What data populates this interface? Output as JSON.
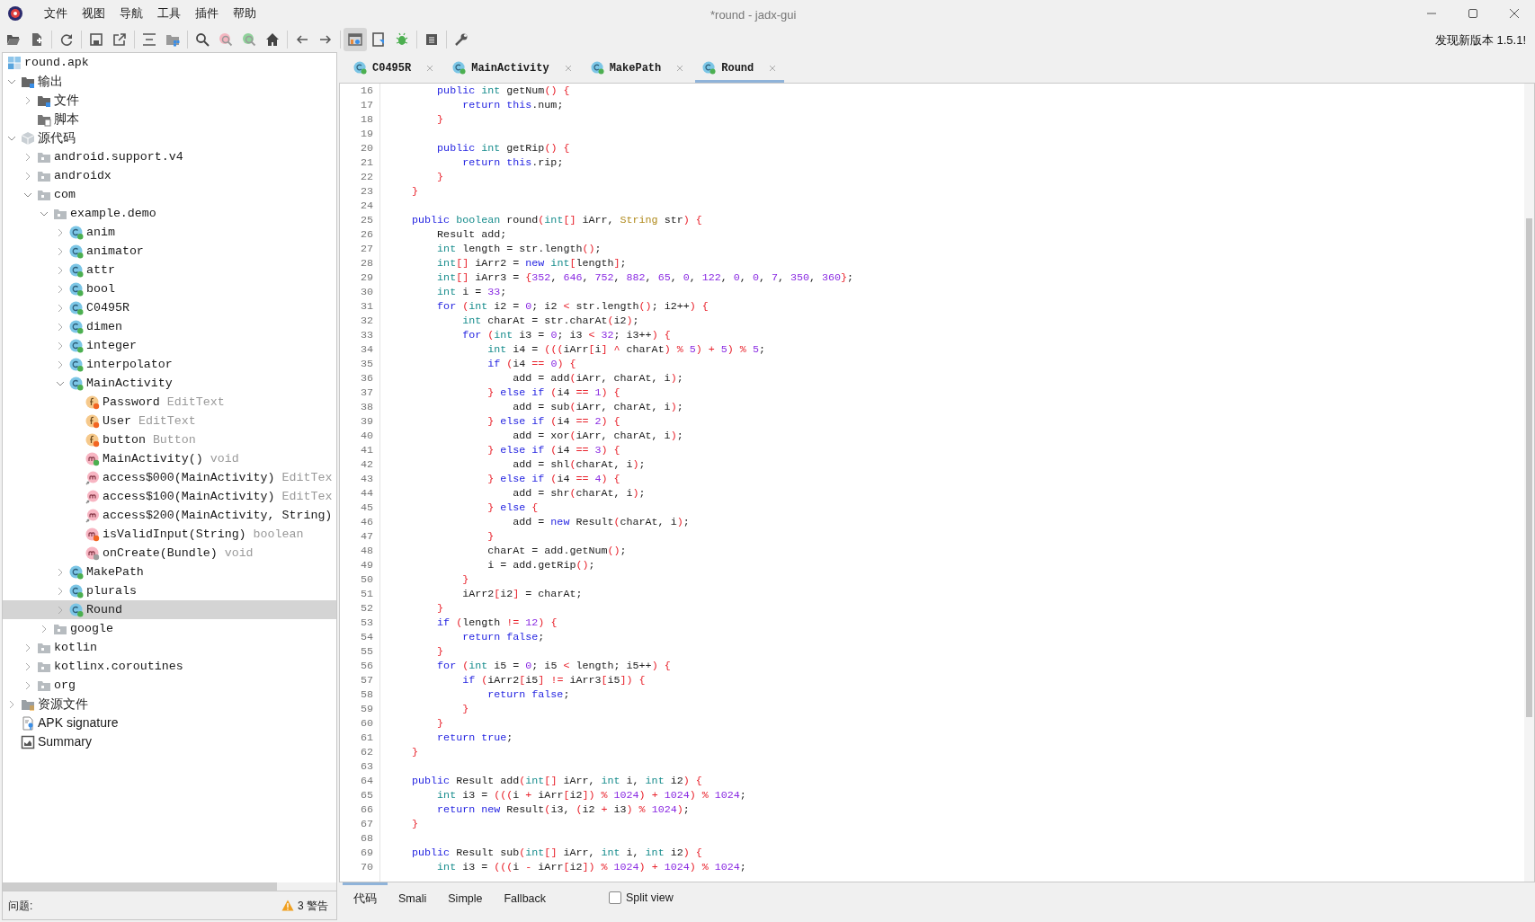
{
  "window": {
    "title": "*round - jadx-gui"
  },
  "menu": [
    "文件",
    "视图",
    "导航",
    "工具",
    "插件",
    "帮助"
  ],
  "update_notice": "发现新版本 1.5.1!",
  "tree": {
    "label": "round.apk",
    "kind": "apk",
    "selected": false,
    "children": [
      {
        "label": "输出",
        "kind": "output",
        "expanded": true,
        "selected": false,
        "children": [
          {
            "label": "文件",
            "kind": "output",
            "expanded": false,
            "selected": false
          },
          {
            "label": "脚本",
            "kind": "script-folder",
            "selected": false
          }
        ]
      },
      {
        "label": "源代码",
        "kind": "sources",
        "expanded": true,
        "selected": false,
        "children": [
          {
            "label": "android.support.v4",
            "kind": "package",
            "expanded": false,
            "selected": false
          },
          {
            "label": "androidx",
            "kind": "package",
            "expanded": false,
            "selected": false
          },
          {
            "label": "com",
            "kind": "package",
            "expanded": true,
            "selected": false,
            "children": [
              {
                "label": "example.demo",
                "kind": "package",
                "expanded": true,
                "selected": false,
                "children": [
                  {
                    "label": "anim",
                    "kind": "class",
                    "expanded": false,
                    "selected": false
                  },
                  {
                    "label": "animator",
                    "kind": "class",
                    "expanded": false,
                    "selected": false
                  },
                  {
                    "label": "attr",
                    "kind": "class",
                    "expanded": false,
                    "selected": false
                  },
                  {
                    "label": "bool",
                    "kind": "class",
                    "expanded": false,
                    "selected": false
                  },
                  {
                    "label": "C0495R",
                    "kind": "class",
                    "expanded": false,
                    "selected": false
                  },
                  {
                    "label": "dimen",
                    "kind": "class",
                    "expanded": false,
                    "selected": false
                  },
                  {
                    "label": "integer",
                    "kind": "class",
                    "expanded": false,
                    "selected": false
                  },
                  {
                    "label": "interpolator",
                    "kind": "class",
                    "expanded": false,
                    "selected": false
                  },
                  {
                    "label": "MainActivity",
                    "kind": "class",
                    "expanded": true,
                    "selected": false,
                    "children": [
                      {
                        "label": "Password",
                        "detail": "EditText",
                        "kind": "field",
                        "color": "#f26522",
                        "selected": false
                      },
                      {
                        "label": "User",
                        "detail": "EditText",
                        "kind": "field",
                        "color": "#f26522",
                        "selected": false
                      },
                      {
                        "label": "button",
                        "detail": "Button",
                        "kind": "field",
                        "color": "#f26522",
                        "selected": false
                      },
                      {
                        "label": "MainActivity()",
                        "detail": "void",
                        "kind": "method",
                        "color": "#4caf50",
                        "selected": false
                      },
                      {
                        "label": "access$000(MainActivity)",
                        "detail": "EditTex",
                        "kind": "accessor",
                        "selected": false
                      },
                      {
                        "label": "access$100(MainActivity)",
                        "detail": "EditTex",
                        "kind": "accessor",
                        "selected": false
                      },
                      {
                        "label": "access$200(MainActivity, String)",
                        "kind": "accessor",
                        "selected": false
                      },
                      {
                        "label": "isValidInput(String)",
                        "detail": "boolean",
                        "kind": "method",
                        "color": "#f26522",
                        "selected": false
                      },
                      {
                        "label": "onCreate(Bundle)",
                        "detail": "void",
                        "kind": "method",
                        "color": "#9e9e9e",
                        "selected": false
                      }
                    ]
                  },
                  {
                    "label": "MakePath",
                    "kind": "class",
                    "expanded": false,
                    "selected": false
                  },
                  {
                    "label": "plurals",
                    "kind": "class",
                    "expanded": false,
                    "selected": false
                  },
                  {
                    "label": "Round",
                    "kind": "class",
                    "expanded": false,
                    "selected": true
                  }
                ]
              },
              {
                "label": "google",
                "kind": "package",
                "expanded": false,
                "selected": false
              }
            ]
          },
          {
            "label": "kotlin",
            "kind": "package",
            "expanded": false,
            "selected": false
          },
          {
            "label": "kotlinx.coroutines",
            "kind": "package",
            "expanded": false,
            "selected": false
          },
          {
            "label": "org",
            "kind": "package",
            "expanded": false,
            "selected": false
          }
        ]
      },
      {
        "label": "资源文件",
        "kind": "resources",
        "expanded": false,
        "selected": false
      },
      {
        "label": "APK signature",
        "kind": "signature",
        "selected": false
      },
      {
        "label": "Summary",
        "kind": "summary",
        "selected": false
      }
    ]
  },
  "problems": {
    "label": "问题:",
    "warnings": "3 警告"
  },
  "editor_tabs": [
    {
      "label": "C0495R",
      "selected": false
    },
    {
      "label": "MainActivity",
      "selected": false
    },
    {
      "label": "MakePath",
      "selected": false
    },
    {
      "label": "Round",
      "selected": true
    }
  ],
  "code_lines": [
    {
      "n": "16",
      "segs": [
        {
          "text": "        public",
          "kind": "keyword"
        },
        {
          "text": " int",
          "kind": "type"
        },
        {
          "text": " getNum() {",
          "kind": "plain"
        }
      ]
    },
    {
      "n": "17",
      "segs": [
        {
          "text": "            return this",
          "kind": "keyword"
        },
        {
          "text": ".num;",
          "kind": "plain"
        }
      ]
    },
    {
      "n": "18",
      "segs": [
        {
          "text": "        }",
          "kind": "plain"
        }
      ]
    },
    {
      "n": "19"
    },
    {
      "n": "20",
      "segs": [
        {
          "text": "        public",
          "kind": "keyword"
        },
        {
          "text": " int",
          "kind": "type"
        },
        {
          "text": " getRip() {",
          "kind": "plain"
        }
      ]
    },
    {
      "n": "21",
      "segs": [
        {
          "text": "            return this",
          "kind": "keyword"
        },
        {
          "text": ".rip;",
          "kind": "plain"
        }
      ]
    },
    {
      "n": "22",
      "segs": [
        {
          "text": "        }",
          "kind": "plain"
        }
      ]
    },
    {
      "n": "23",
      "segs": [
        {
          "text": "    }",
          "kind": "plain"
        }
      ]
    },
    {
      "n": "24"
    },
    {
      "n": "25",
      "segs": [
        {
          "text": "    public",
          "kind": "keyword"
        },
        {
          "text": " boolean",
          "kind": "type"
        },
        {
          "text": " round(",
          "kind": "plain"
        },
        {
          "text": "int",
          "kind": "type"
        },
        {
          "text": "[] iArr,",
          "kind": "plain"
        },
        {
          "text": " String",
          "kind": "class"
        },
        {
          "text": " str) {",
          "kind": "plain"
        }
      ]
    },
    {
      "n": "26",
      "segs": [
        {
          "text": "        Result add;",
          "kind": "plain"
        }
      ]
    },
    {
      "n": "27",
      "segs": [
        {
          "text": "        int",
          "kind": "type"
        },
        {
          "text": " length = str.length();",
          "kind": "plain"
        }
      ]
    },
    {
      "n": "28",
      "segs": [
        {
          "text": "        int",
          "kind": "type"
        },
        {
          "text": "[] iArr2 =",
          "kind": "plain"
        },
        {
          "text": " new",
          "kind": "keyword"
        },
        {
          "text": " int",
          "kind": "type"
        },
        {
          "text": "[length];",
          "kind": "plain"
        }
      ]
    },
    {
      "n": "29",
      "segs": [
        {
          "text": "        int",
          "kind": "type"
        },
        {
          "text": "[] iArr3 = {352, 646, 752, 882, 65, 0, 122, 0, 0, 7, 350, 360};",
          "kind": "plain"
        }
      ]
    },
    {
      "n": "30",
      "segs": [
        {
          "text": "        int",
          "kind": "type"
        },
        {
          "text": " i = 33;",
          "kind": "plain"
        }
      ]
    },
    {
      "n": "31",
      "segs": [
        {
          "text": "        for",
          "kind": "keyword"
        },
        {
          "text": " (",
          "kind": "plain"
        },
        {
          "text": "int",
          "kind": "type"
        },
        {
          "text": " i2 = 0; i2 < str.length(); i2++) {",
          "kind": "plain"
        }
      ]
    },
    {
      "n": "32",
      "segs": [
        {
          "text": "            int",
          "kind": "type"
        },
        {
          "text": " charAt = str.charAt(i2);",
          "kind": "plain"
        }
      ]
    },
    {
      "n": "33",
      "segs": [
        {
          "text": "            for",
          "kind": "keyword"
        },
        {
          "text": " (",
          "kind": "plain"
        },
        {
          "text": "int",
          "kind": "type"
        },
        {
          "text": " i3 = 0; i3 < 32; i3++) {",
          "kind": "plain"
        }
      ]
    },
    {
      "n": "34",
      "segs": [
        {
          "text": "                int",
          "kind": "type"
        },
        {
          "text": " i4 = (((iArr[i] ^ charAt) % 5) + 5) % 5;",
          "kind": "plain"
        }
      ]
    },
    {
      "n": "35",
      "segs": [
        {
          "text": "                if",
          "kind": "keyword"
        },
        {
          "text": " (i4 == 0) {",
          "kind": "plain"
        }
      ]
    },
    {
      "n": "36",
      "segs": [
        {
          "text": "                    add = add(iArr, charAt, i);",
          "kind": "plain"
        }
      ]
    },
    {
      "n": "37",
      "segs": [
        {
          "text": "                }",
          "kind": "plain"
        },
        {
          "text": " else if",
          "kind": "keyword"
        },
        {
          "text": " (i4 == 1) {",
          "kind": "plain"
        }
      ]
    },
    {
      "n": "38",
      "segs": [
        {
          "text": "                    add = sub(iArr, charAt, i);",
          "kind": "plain"
        }
      ]
    },
    {
      "n": "39",
      "segs": [
        {
          "text": "                }",
          "kind": "plain"
        },
        {
          "text": " else if",
          "kind": "keyword"
        },
        {
          "text": " (i4 == 2) {",
          "kind": "plain"
        }
      ]
    },
    {
      "n": "40",
      "segs": [
        {
          "text": "                    add = xor(iArr, charAt, i);",
          "kind": "plain"
        }
      ]
    },
    {
      "n": "41",
      "segs": [
        {
          "text": "                }",
          "kind": "plain"
        },
        {
          "text": " else if",
          "kind": "keyword"
        },
        {
          "text": " (i4 == 3) {",
          "kind": "plain"
        }
      ]
    },
    {
      "n": "42",
      "segs": [
        {
          "text": "                    add = shl(charAt, i);",
          "kind": "plain"
        }
      ]
    },
    {
      "n": "43",
      "segs": [
        {
          "text": "                }",
          "kind": "plain"
        },
        {
          "text": " else if",
          "kind": "keyword"
        },
        {
          "text": " (i4 == 4) {",
          "kind": "plain"
        }
      ]
    },
    {
      "n": "44",
      "segs": [
        {
          "text": "                    add = shr(charAt, i);",
          "kind": "plain"
        }
      ]
    },
    {
      "n": "45",
      "segs": [
        {
          "text": "                }",
          "kind": "plain"
        },
        {
          "text": " else",
          "kind": "keyword"
        },
        {
          "text": " {",
          "kind": "plain"
        }
      ]
    },
    {
      "n": "46",
      "segs": [
        {
          "text": "                    add =",
          "kind": "plain"
        },
        {
          "text": " new",
          "kind": "keyword"
        },
        {
          "text": " Result(charAt, i);",
          "kind": "plain"
        }
      ]
    },
    {
      "n": "47",
      "segs": [
        {
          "text": "                }",
          "kind": "plain"
        }
      ]
    },
    {
      "n": "48",
      "segs": [
        {
          "text": "                charAt = add.getNum();",
          "kind": "plain"
        }
      ]
    },
    {
      "n": "49",
      "segs": [
        {
          "text": "                i = add.getRip();",
          "kind": "plain"
        }
      ]
    },
    {
      "n": "50",
      "segs": [
        {
          "text": "            }",
          "kind": "plain"
        }
      ]
    },
    {
      "n": "51",
      "segs": [
        {
          "text": "            iArr2[i2] = charAt;",
          "kind": "plain"
        }
      ]
    },
    {
      "n": "52",
      "segs": [
        {
          "text": "        }",
          "kind": "plain"
        }
      ]
    },
    {
      "n": "53",
      "segs": [
        {
          "text": "        if",
          "kind": "keyword"
        },
        {
          "text": " (length != 12) {",
          "kind": "plain"
        }
      ]
    },
    {
      "n": "54",
      "segs": [
        {
          "text": "            return false",
          "kind": "keyword"
        },
        {
          "text": ";",
          "kind": "plain"
        }
      ]
    },
    {
      "n": "55",
      "segs": [
        {
          "text": "        }",
          "kind": "plain"
        }
      ]
    },
    {
      "n": "56",
      "segs": [
        {
          "text": "        for",
          "kind": "keyword"
        },
        {
          "text": " (",
          "kind": "plain"
        },
        {
          "text": "int",
          "kind": "type"
        },
        {
          "text": " i5 = 0; i5 < length; i5++) {",
          "kind": "plain"
        }
      ]
    },
    {
      "n": "57",
      "segs": [
        {
          "text": "            if",
          "kind": "keyword"
        },
        {
          "text": " (iArr2[i5] != iArr3[i5]) {",
          "kind": "plain"
        }
      ]
    },
    {
      "n": "58",
      "segs": [
        {
          "text": "                return false",
          "kind": "keyword"
        },
        {
          "text": ";",
          "kind": "plain"
        }
      ]
    },
    {
      "n": "59",
      "segs": [
        {
          "text": "            }",
          "kind": "plain"
        }
      ]
    },
    {
      "n": "60",
      "segs": [
        {
          "text": "        }",
          "kind": "plain"
        }
      ]
    },
    {
      "n": "61",
      "segs": [
        {
          "text": "        return true",
          "kind": "keyword"
        },
        {
          "text": ";",
          "kind": "plain"
        }
      ]
    },
    {
      "n": "62",
      "segs": [
        {
          "text": "    }",
          "kind": "plain"
        }
      ]
    },
    {
      "n": "63"
    },
    {
      "n": "64",
      "segs": [
        {
          "text": "    public",
          "kind": "keyword"
        },
        {
          "text": " Result add(",
          "kind": "plain"
        },
        {
          "text": "int",
          "kind": "type"
        },
        {
          "text": "[] iArr,",
          "kind": "plain"
        },
        {
          "text": " int",
          "kind": "type"
        },
        {
          "text": " i,",
          "kind": "plain"
        },
        {
          "text": " int",
          "kind": "type"
        },
        {
          "text": " i2) {",
          "kind": "plain"
        }
      ]
    },
    {
      "n": "65",
      "segs": [
        {
          "text": "        int",
          "kind": "type"
        },
        {
          "text": " i3 = (((i + iArr[i2]) % 1024) + 1024) % 1024;",
          "kind": "plain"
        }
      ]
    },
    {
      "n": "66",
      "segs": [
        {
          "text": "        return new",
          "kind": "keyword"
        },
        {
          "text": " Result(i3, (i2 + i3) % 1024);",
          "kind": "plain"
        }
      ]
    },
    {
      "n": "67",
      "segs": [
        {
          "text": "    }",
          "kind": "plain"
        }
      ]
    },
    {
      "n": "68"
    },
    {
      "n": "69",
      "segs": [
        {
          "text": "    public",
          "kind": "keyword"
        },
        {
          "text": " Result sub(",
          "kind": "plain"
        },
        {
          "text": "int",
          "kind": "type"
        },
        {
          "text": "[] iArr,",
          "kind": "plain"
        },
        {
          "text": " int",
          "kind": "type"
        },
        {
          "text": " i,",
          "kind": "plain"
        },
        {
          "text": " int",
          "kind": "type"
        },
        {
          "text": " i2) {",
          "kind": "plain"
        }
      ]
    },
    {
      "n": "70",
      "segs": [
        {
          "text": "        int",
          "kind": "type"
        },
        {
          "text": " i3 = (((i - iArr[i2]) % 1024) + 1024) % 1024;",
          "kind": "plain"
        }
      ]
    }
  ],
  "view_tabs": [
    {
      "label": "代码",
      "selected": true
    },
    {
      "label": "Smali",
      "selected": false
    },
    {
      "label": "Simple",
      "selected": false
    },
    {
      "label": "Fallback",
      "selected": false
    }
  ],
  "split_view": {
    "label": "Split view",
    "checked": false
  }
}
